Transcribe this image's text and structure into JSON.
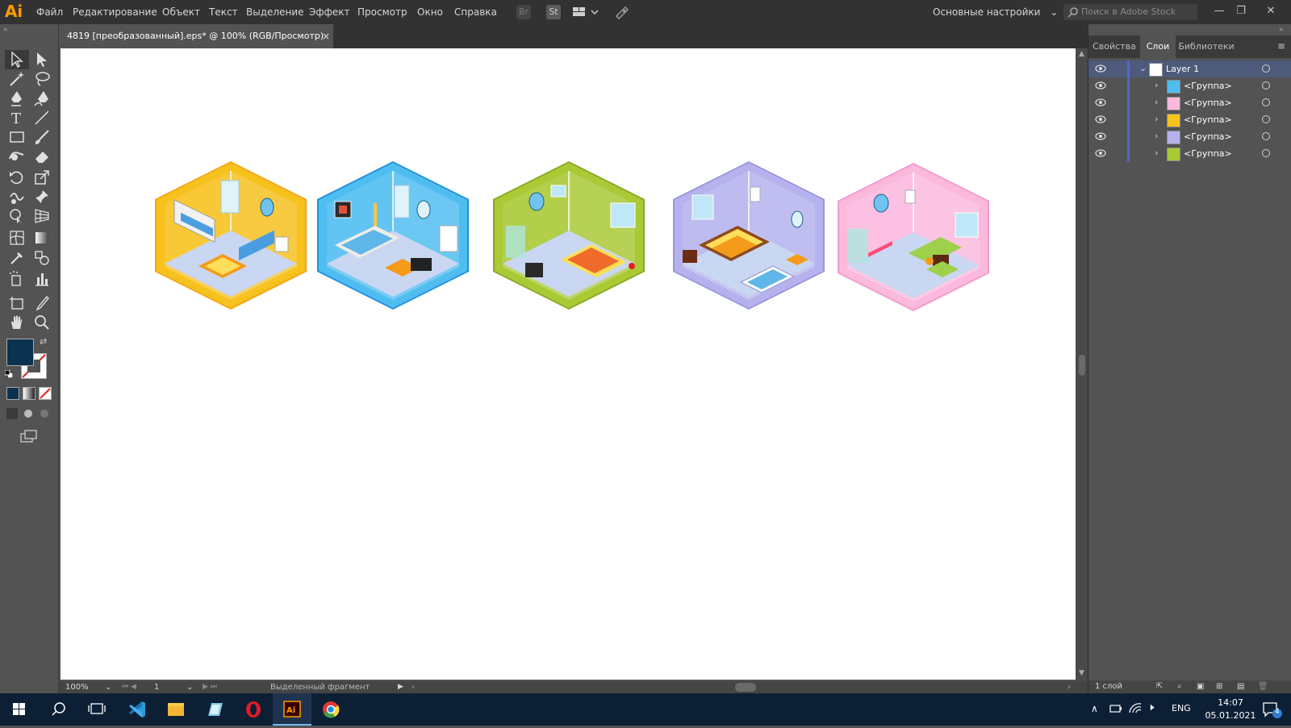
{
  "app": {
    "logo": "Ai"
  },
  "menu": {
    "items": [
      {
        "label": "Файл",
        "name": "menu-file"
      },
      {
        "label": "Редактирование",
        "name": "menu-edit"
      },
      {
        "label": "Объект",
        "name": "menu-object"
      },
      {
        "label": "Текст",
        "name": "menu-text"
      },
      {
        "label": "Выделение",
        "name": "menu-select"
      },
      {
        "label": "Эффект",
        "name": "menu-effect"
      },
      {
        "label": "Просмотр",
        "name": "menu-view"
      },
      {
        "label": "Окно",
        "name": "menu-window"
      },
      {
        "label": "Справка",
        "name": "menu-help"
      }
    ],
    "bridge": "Br",
    "stock": "St"
  },
  "workspace": {
    "label": "Основные настройки"
  },
  "search": {
    "placeholder": "Поиск в Adobe Stock"
  },
  "document": {
    "tab_title": "4819 [преобразованный].eps* @ 100% (RGB/Просмотр)",
    "close": "×"
  },
  "colors": {
    "fill": "#0b3350",
    "accent": "#4a6ac9",
    "artboard": "#ffffff"
  },
  "statusbar": {
    "zoom": "100%",
    "page": "1",
    "status": "Выделенный фрагмент"
  },
  "panel": {
    "tabs": [
      "Свойства",
      "Слои",
      "Библиотеки"
    ],
    "active_tab": "Слои",
    "layer": {
      "name": "Layer 1"
    },
    "groups": [
      "<Группа>",
      "<Группа>",
      "<Группа>",
      "<Группа>",
      "<Группа>"
    ],
    "footer": "1 слой"
  },
  "taskbar": {
    "lang": "ENG",
    "time": "14:07",
    "date": "05.01.2021",
    "notifications": "4"
  },
  "artwork": [
    {
      "theme": "yellow",
      "wall": "#f7c11e",
      "edge": "#f3a612"
    },
    {
      "theme": "blue",
      "wall": "#4fbdf0",
      "edge": "#1f8fdb"
    },
    {
      "theme": "green",
      "wall": "#a9c935",
      "edge": "#8aa922"
    },
    {
      "theme": "purple",
      "wall": "#b5b2ee",
      "edge": "#9a96dd"
    },
    {
      "theme": "pink",
      "wall": "#fbb9de",
      "edge": "#f29acb"
    }
  ]
}
